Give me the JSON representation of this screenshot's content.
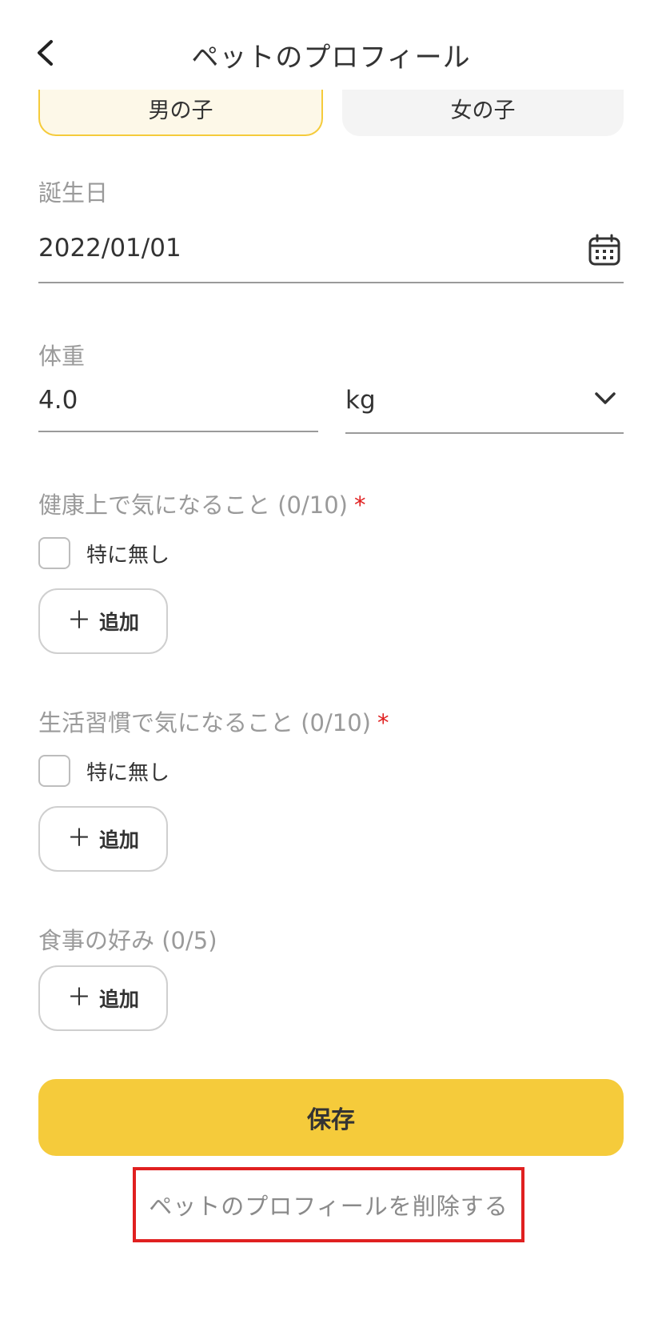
{
  "header": {
    "title": "ペットのプロフィール",
    "back_icon": "chevron-left-icon"
  },
  "gender": {
    "options": [
      {
        "label": "男の子",
        "selected": true
      },
      {
        "label": "女の子",
        "selected": false
      }
    ],
    "selected_color": "#f5cb3b"
  },
  "birthday": {
    "label": "誕生日",
    "value": "2022/01/01",
    "icon": "calendar-icon"
  },
  "weight": {
    "label": "体重",
    "value": "4.0",
    "unit": "kg",
    "unit_icon": "chevron-down-icon"
  },
  "health_concerns": {
    "label": "健康上で気になること (0/10)",
    "required_mark": "*",
    "none_label": "特に無し",
    "none_checked": false,
    "add_label": "追加"
  },
  "lifestyle_concerns": {
    "label": "生活習慣で気になること (0/10)",
    "required_mark": "*",
    "none_label": "特に無し",
    "none_checked": false,
    "add_label": "追加"
  },
  "food_preferences": {
    "label": "食事の好み (0/5)",
    "add_label": "追加"
  },
  "actions": {
    "save_label": "保存",
    "delete_label": "ペットのプロフィールを削除する"
  },
  "colors": {
    "accent": "#f5cb3b",
    "required": "#e02020",
    "highlight_border": "#e02020"
  }
}
